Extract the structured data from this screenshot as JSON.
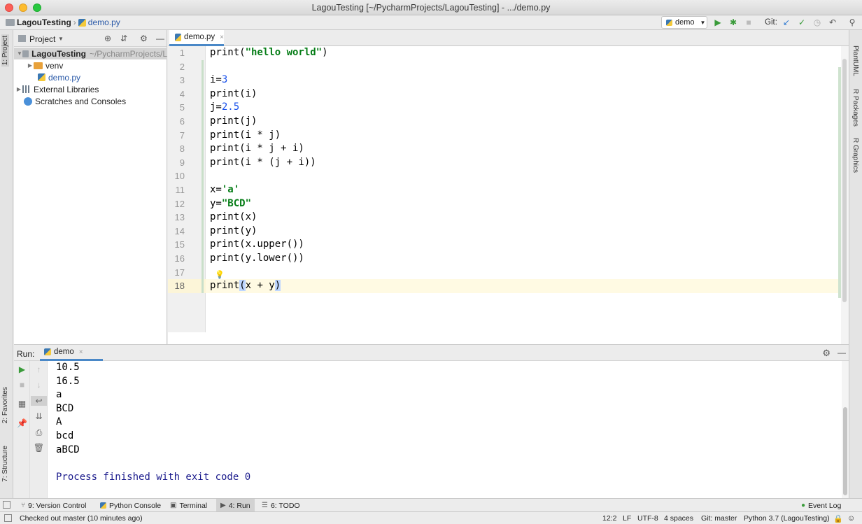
{
  "window": {
    "title": "LagouTesting [~/PycharmProjects/LagouTesting] - .../demo.py"
  },
  "navbar": {
    "project": "LagouTesting",
    "file": "demo.py",
    "run_config": "demo",
    "git_label": "Git:"
  },
  "left_stripe": {
    "project_tab": "1: Project",
    "favorites_tab": "2: Favorites",
    "structure_tab": "7: Structure"
  },
  "right_stripe": {
    "tabs": [
      "PlantUML",
      "R Packages",
      "R Graphics"
    ]
  },
  "project_panel": {
    "title": "Project",
    "root_name": "LagouTesting",
    "root_path": "~/PycharmProjects/L",
    "venv": "venv",
    "demo_file": "demo.py",
    "external_libraries": "External Libraries",
    "scratches": "Scratches and Consoles"
  },
  "editor": {
    "tab_label": "demo.py",
    "line_numbers": [
      "1",
      "2",
      "3",
      "4",
      "5",
      "6",
      "7",
      "8",
      "9",
      "10",
      "11",
      "12",
      "13",
      "14",
      "15",
      "16",
      "17",
      "18"
    ]
  },
  "run_panel": {
    "label": "Run:",
    "tab_label": "demo",
    "output": [
      "10.5",
      "16.5",
      "a",
      "BCD",
      "A",
      "bcd",
      "aBCD",
      "",
      "Process finished with exit code 0"
    ]
  },
  "tool_tabs": {
    "version_control": "9: Version Control",
    "python_console": "Python Console",
    "terminal": "Terminal",
    "run": "4: Run",
    "todo": "6: TODO",
    "event_log": "Event Log"
  },
  "status_bar": {
    "message": "Checked out master (10 minutes ago)",
    "position": "12:2",
    "line_sep": "LF",
    "encoding": "UTF-8",
    "indent": "4 spaces",
    "git_branch": "Git: master",
    "interpreter": "Python 3.7 (LagouTesting)"
  },
  "colors": {
    "accent_tab": "#4a88c7",
    "string": "#067d17",
    "number": "#1750eb",
    "current_line": "#fffae3",
    "process_text": "#1a1a8c"
  }
}
